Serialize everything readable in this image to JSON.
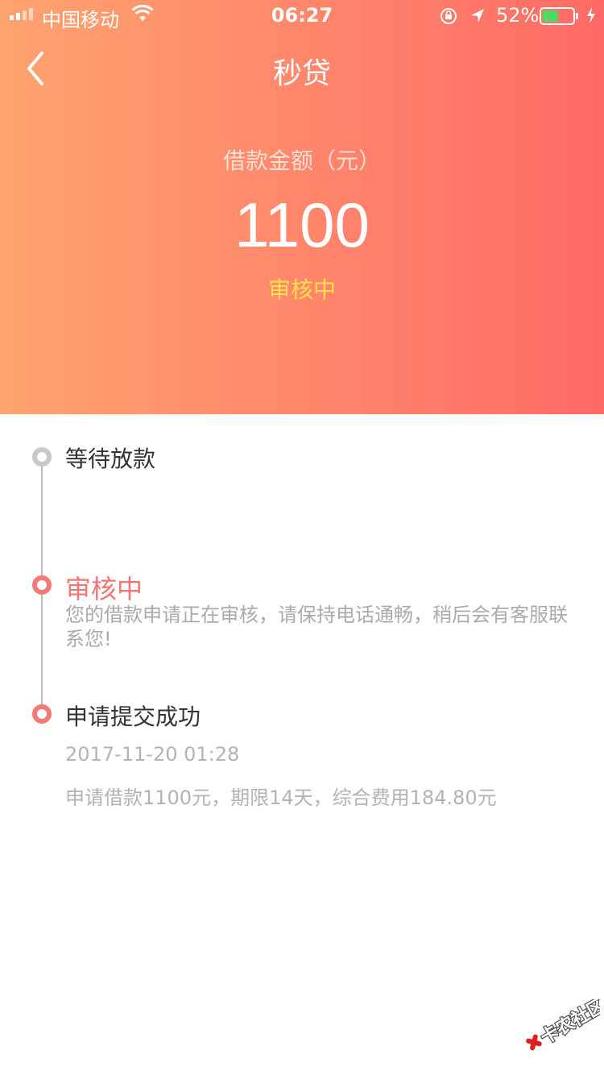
{
  "status_bar": {
    "carrier": "中国移动",
    "time": "06:27",
    "battery_percent": "52%",
    "battery_level": 0.52,
    "battery_color": "#4cd964"
  },
  "nav": {
    "back_icon": "chevron-left-icon",
    "title": "秒贷"
  },
  "loan": {
    "amount_label": "借款金额（元）",
    "amount": "1100",
    "status": "审核中"
  },
  "timeline": [
    {
      "title": "等待放款",
      "state": "pending"
    },
    {
      "title": "审核中",
      "description": "您的借款申请正在审核，请保持电话通畅，稍后会有客服联系您!",
      "state": "active"
    },
    {
      "title": "申请提交成功",
      "timestamp": "2017-11-20 01:28",
      "description": "申请借款1100元，期限14天，综合费用184.80元",
      "state": "done"
    }
  ],
  "watermark": {
    "text": "卡农社区"
  },
  "colors": {
    "gradient_start": "#ffa36e",
    "gradient_end": "#ff6a66",
    "status_text": "#ffe24a",
    "active_red": "#f27474"
  }
}
